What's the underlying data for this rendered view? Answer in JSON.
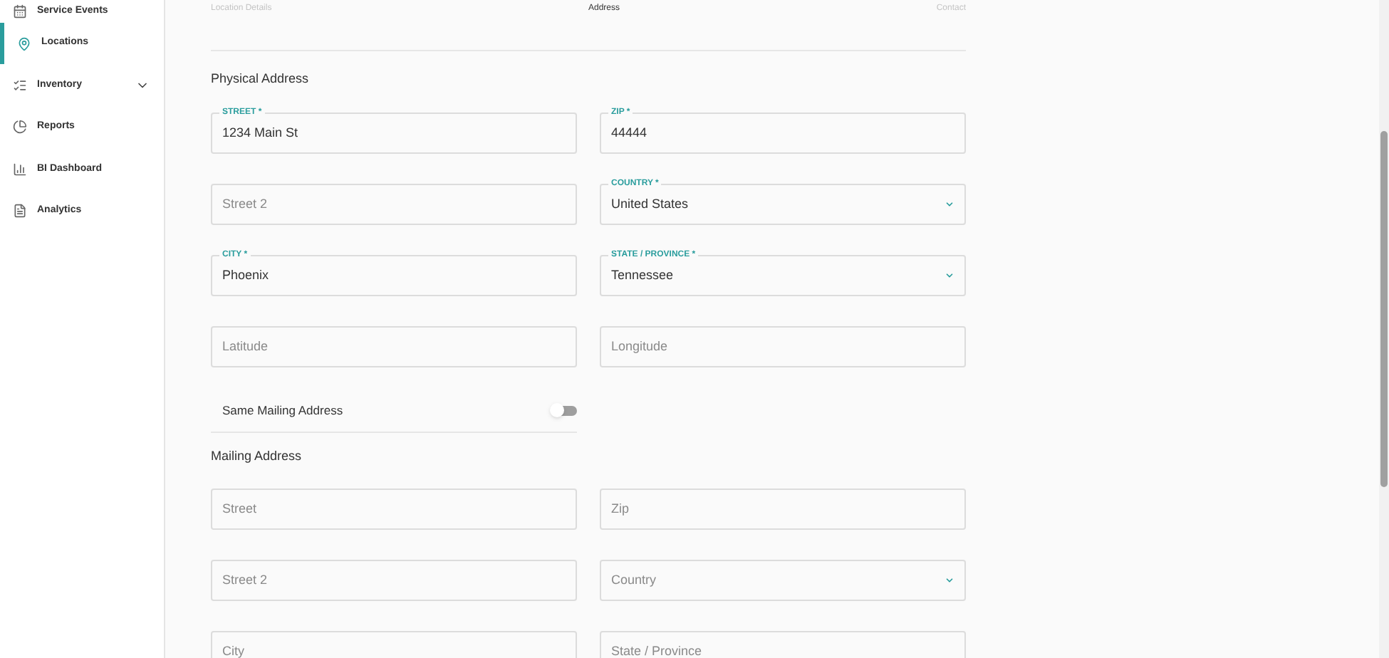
{
  "sidebar": {
    "items": [
      {
        "label": "Service Events",
        "selected": false
      },
      {
        "label": "Locations",
        "selected": true
      },
      {
        "label": "Inventory",
        "selected": false,
        "expanded": false
      },
      {
        "label": "Reports",
        "selected": false
      },
      {
        "label": "BI Dashboard",
        "selected": false
      },
      {
        "label": "Analytics",
        "selected": false
      }
    ]
  },
  "steps": [
    {
      "label": "Location Details",
      "selected": false
    },
    {
      "label": "Address",
      "selected": true
    },
    {
      "label": "Contact",
      "selected": false
    }
  ],
  "physical_address": {
    "title": "Physical Address",
    "rows": [
      {
        "left": {
          "kind": "text",
          "label": "STREET *",
          "value": "1234 Main St"
        },
        "right": {
          "kind": "text",
          "label": "ZIP *",
          "value": "44444"
        }
      },
      {
        "left": {
          "kind": "text",
          "placeholder": "Street 2"
        },
        "right": {
          "kind": "select",
          "label": "COUNTRY *",
          "value": "United States"
        }
      },
      {
        "left": {
          "kind": "text",
          "label": "CITY *",
          "value": "Phoenix"
        },
        "right": {
          "kind": "select",
          "label": "STATE / PROVINCE *",
          "value": "Tennessee"
        }
      },
      {
        "left": {
          "kind": "text",
          "placeholder": "Latitude"
        },
        "right": {
          "kind": "text",
          "placeholder": "Longitude"
        }
      }
    ]
  },
  "same_mailing": {
    "label": "Same Mailing Address",
    "on": false
  },
  "mailing_address": {
    "title": "Mailing Address",
    "rows": [
      {
        "left": {
          "kind": "text",
          "placeholder": "Street"
        },
        "right": {
          "kind": "text",
          "placeholder": "Zip"
        }
      },
      {
        "left": {
          "kind": "text",
          "placeholder": "Street 2"
        },
        "right": {
          "kind": "select",
          "placeholder": "Country"
        }
      },
      {
        "left": {
          "kind": "text",
          "placeholder": "City"
        },
        "right": {
          "kind": "text",
          "placeholder": "State / Province"
        }
      }
    ]
  }
}
